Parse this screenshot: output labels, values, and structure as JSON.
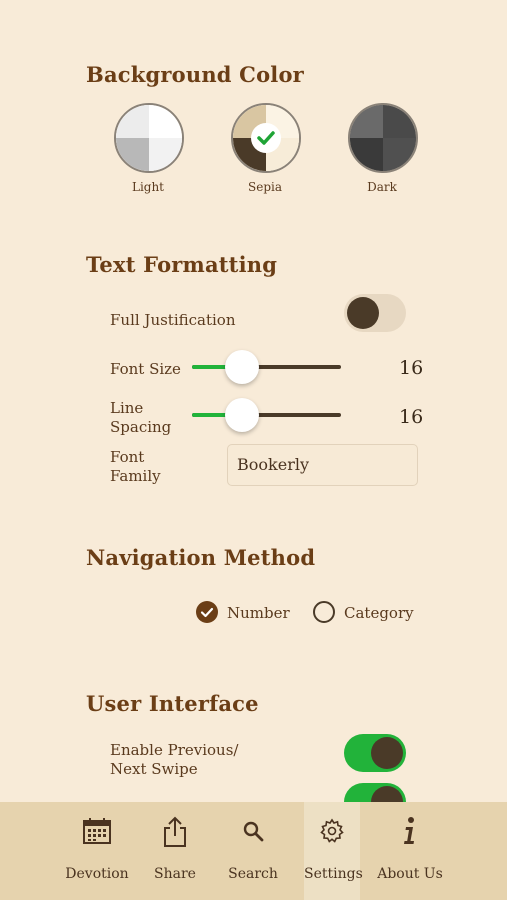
{
  "background_color": {
    "title": "Background Color",
    "options": [
      {
        "label": "Light",
        "selected": false
      },
      {
        "label": "Sepia",
        "selected": true
      },
      {
        "label": "Dark",
        "selected": false
      }
    ]
  },
  "text_formatting": {
    "title": "Text Formatting",
    "full_justification": {
      "label": "Full Justification",
      "on": false
    },
    "font_size": {
      "label": "Font Size",
      "value": "16",
      "fraction": 0.34
    },
    "line_spacing": {
      "label_line1": "Line",
      "label_line2": "Spacing",
      "value": "16",
      "fraction": 0.34
    },
    "font_family": {
      "label_line1": "Font",
      "label_line2": "Family",
      "value": "Bookerly"
    }
  },
  "navigation_method": {
    "title": "Navigation Method",
    "options": [
      {
        "label": "Number",
        "selected": true
      },
      {
        "label": "Category",
        "selected": false
      }
    ]
  },
  "user_interface": {
    "title": "User Interface",
    "swipe": {
      "label_line1": "Enable Previous/",
      "label_line2": "Next Swipe",
      "on": true
    }
  },
  "tabbar": {
    "tabs": [
      {
        "label": "Devotion",
        "icon": "calendar-icon",
        "active": false
      },
      {
        "label": "Share",
        "icon": "share-icon",
        "active": false
      },
      {
        "label": "Search",
        "icon": "search-icon",
        "active": false
      },
      {
        "label": "Settings",
        "icon": "gear-icon",
        "active": true
      },
      {
        "label": "About Us",
        "icon": "info-icon",
        "active": false
      }
    ]
  },
  "colors": {
    "background": "#f8ebd8",
    "heading": "#6b3e16",
    "accent_green": "#22b33a",
    "tabbar": "#e6d3ae"
  }
}
